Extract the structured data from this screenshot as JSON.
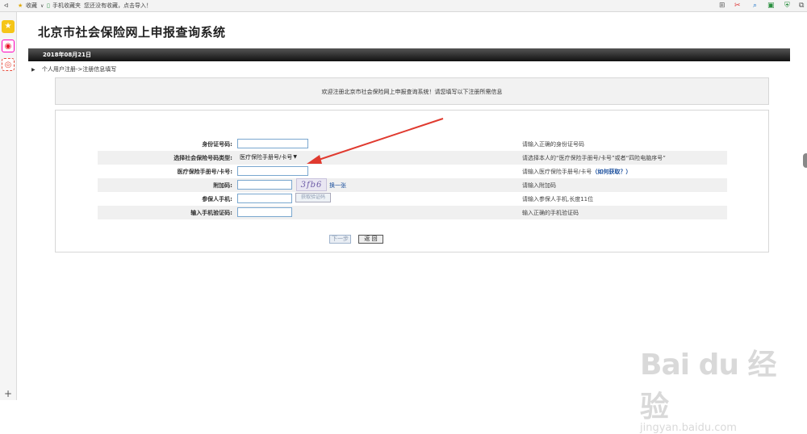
{
  "browser": {
    "back_glyph": "ᐊ",
    "favorites_label": "收藏",
    "mobile_favorites_label": "手机收藏夹",
    "import_prompt": "您还没有收藏，点击导入！",
    "icons": [
      "cut-icon",
      "search-icon",
      "game-icon",
      "shield-icon",
      "window-icon"
    ]
  },
  "sidebar": {
    "items": [
      {
        "icon": "star-icon",
        "glyph": "★",
        "color": "#f1c40f"
      },
      {
        "icon": "weibo-icon",
        "glyph": "◉",
        "color": "#e6162d"
      },
      {
        "icon": "target-icon",
        "glyph": "◎",
        "color": "#e74c3c"
      }
    ],
    "add_glyph": "+"
  },
  "page": {
    "title": "北京市社会保险网上申报查询系统",
    "date": "2018年08月21日",
    "breadcrumb": "个人用户注册->注册信息填写",
    "welcome": "欢迎注册北京市社会保险网上申报查询系统！请您填写以下注册所需信息"
  },
  "form": {
    "id_number": {
      "label": "身份证号码:",
      "value": "",
      "hint": "请输入正确的身份证号码"
    },
    "insurance_type": {
      "label": "选择社会保险号码类型:",
      "selected": "医疗保险手册号/卡号",
      "hint": "请选择本人的“医疗保险手册号/卡号”或者“四险电脑序号”"
    },
    "medical_card": {
      "label": "医疗保险手册号/卡号:",
      "value": "",
      "hint": "请输入医疗保险手册号/卡号",
      "hint_link": "（如何获取？）"
    },
    "extra_code": {
      "label": "附加码:",
      "value": "",
      "captcha_text": "3fb6",
      "swap_label": "换一张",
      "hint": "请输入附加码"
    },
    "phone": {
      "label": "参保人手机:",
      "value": "",
      "sms_button": "获取验证码",
      "hint": "请输入参保人手机,长度11位"
    },
    "sms_code": {
      "label": "输入手机验证码:",
      "value": "",
      "hint": "输入正确的手机验证码"
    },
    "next_button": "下一步",
    "back_button": "返 回"
  },
  "watermark": {
    "brand": "Bai du 经验",
    "url": "jingyan.baidu.com"
  }
}
